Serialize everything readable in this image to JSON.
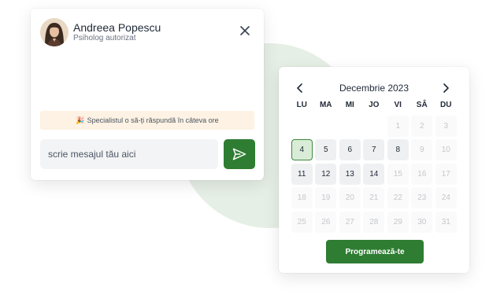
{
  "chat": {
    "name": "Andreea Popescu",
    "role": "Psiholog autorizat",
    "notice_icon": "🎉",
    "notice_text": "Specialistul o să-ți răspundă în câteva ore",
    "input_placeholder": "scrie mesajul tău aici"
  },
  "calendar": {
    "month_label": "Decembrie 2023",
    "weekdays": [
      "LU",
      "MA",
      "MI",
      "JO",
      "VI",
      "SÂ",
      "DU"
    ],
    "leading_empty": 4,
    "days": [
      {
        "n": "1",
        "state": "disabled"
      },
      {
        "n": "2",
        "state": "disabled"
      },
      {
        "n": "3",
        "state": "disabled"
      },
      {
        "n": "4",
        "state": "selected"
      },
      {
        "n": "5",
        "state": "available"
      },
      {
        "n": "6",
        "state": "available"
      },
      {
        "n": "7",
        "state": "available"
      },
      {
        "n": "8",
        "state": "available"
      },
      {
        "n": "9",
        "state": "disabled"
      },
      {
        "n": "10",
        "state": "disabled"
      },
      {
        "n": "11",
        "state": "available"
      },
      {
        "n": "12",
        "state": "available"
      },
      {
        "n": "13",
        "state": "available"
      },
      {
        "n": "14",
        "state": "available"
      },
      {
        "n": "15",
        "state": "disabled"
      },
      {
        "n": "16",
        "state": "disabled"
      },
      {
        "n": "17",
        "state": "disabled"
      },
      {
        "n": "18",
        "state": "disabled"
      },
      {
        "n": "19",
        "state": "disabled"
      },
      {
        "n": "20",
        "state": "disabled"
      },
      {
        "n": "21",
        "state": "disabled"
      },
      {
        "n": "22",
        "state": "disabled"
      },
      {
        "n": "23",
        "state": "disabled"
      },
      {
        "n": "24",
        "state": "disabled"
      },
      {
        "n": "25",
        "state": "disabled"
      },
      {
        "n": "26",
        "state": "disabled"
      },
      {
        "n": "27",
        "state": "disabled"
      },
      {
        "n": "28",
        "state": "disabled"
      },
      {
        "n": "29",
        "state": "disabled"
      },
      {
        "n": "30",
        "state": "disabled"
      },
      {
        "n": "31",
        "state": "disabled"
      }
    ],
    "book_button_label": "Programează-te"
  },
  "icons": {
    "avatar": "avatar",
    "close": "close-icon",
    "send": "send-icon",
    "prev": "chevron-left-icon",
    "next": "chevron-right-icon",
    "party": "party-popper-icon"
  },
  "colors": {
    "accent": "#2e7d32",
    "selected_day_bg": "#d9ecd7",
    "notice_bg": "#fdf2e3",
    "bg_circle": "#e6efe6"
  }
}
